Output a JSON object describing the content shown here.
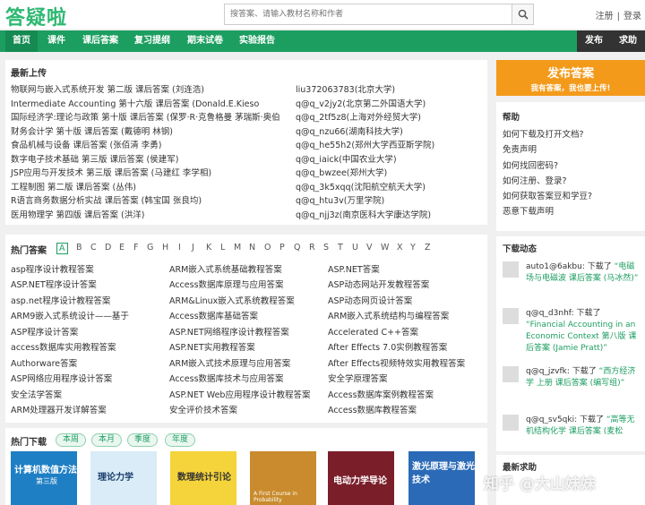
{
  "logo": "答疑啦",
  "search": {
    "placeholder": "搜答案、请输入教材名称和作者"
  },
  "auth": {
    "register": "注册",
    "separator": "|",
    "login": "登录"
  },
  "nav": {
    "items": [
      "首页",
      "课件",
      "课后答案",
      "复习提纲",
      "期末试卷",
      "实验报告"
    ],
    "right": [
      "发布",
      "求助"
    ]
  },
  "latest": {
    "title": "最新上传",
    "rows": [
      {
        "book": "物联网与嵌入式系统开发 第二版 课后答案 (刘连浩)",
        "user": "liu372063783(北京大学)"
      },
      {
        "book": "Intermediate Accounting 第十六版 课后答案 (Donald.E.Kieso",
        "user": "q@q_v2jy2(北京第二外国语大学)"
      },
      {
        "book": "国际经济学:理论与政策 第十版 课后答案 (保罗·R·克鲁格曼 茅瑞斯·奥伯",
        "user": "q@q_2tf5z8(上海对外经贸大学)"
      },
      {
        "book": "财务会计学 第十版 课后答案 (戴德明 林钢)",
        "user": "q@q_nzu66(湖南科技大学)"
      },
      {
        "book": "食品机械与设备 课后答案 (张佰清 李勇)",
        "user": "q@q_he55h2(郑州大学西亚斯学院)"
      },
      {
        "book": "数字电子技术基础 第三版 课后答案 (侯建军)",
        "user": "q@q_iaick(中国农业大学)"
      },
      {
        "book": "JSP应用与开发技术 第三版 课后答案 (马建红 李学相)",
        "user": "q@q_bwzee(郑州大学)"
      },
      {
        "book": "工程制图 第二版 课后答案 (丛伟)",
        "user": "q@q_3k5xqq(沈阳航空航天大学)"
      },
      {
        "book": "R语言商务数据分析实战 课后答案 (韩宝国 张良均)",
        "user": "q@q_htu3v(万里学院)"
      },
      {
        "book": "医用物理学 第四版 课后答案 (洪洋)",
        "user": "q@q_njj3z(南京医科大学康达学院)"
      }
    ]
  },
  "hot": {
    "title": "热门答案",
    "letters": [
      "A",
      "B",
      "C",
      "D",
      "E",
      "F",
      "G",
      "H",
      "I",
      "J",
      "K",
      "L",
      "M",
      "N",
      "O",
      "P",
      "Q",
      "R",
      "S",
      "T",
      "U",
      "V",
      "W",
      "X",
      "Y",
      "Z"
    ],
    "col1": [
      "asp程序设计教程答案",
      "ASP.NET程序设计答案",
      "asp.net程序设计教程答案",
      "ARM9嵌入式系统设计——基于",
      "ASP程序设计答案",
      "access数据库实用教程答案",
      "Authorware答案",
      "ASP网络应用程序设计答案",
      "安全法学答案",
      "ARM处理器开发详解答案"
    ],
    "col2": [
      "ARM嵌入式系统基础教程答案",
      "Access数据库原理与应用答案",
      "ARM&Linux嵌入式系统教程答案",
      "Access数据库基础答案",
      "ASP.NET网络程序设计教程答案",
      "ASP.NET实用教程答案",
      "ARM嵌入式技术原理与应用答案",
      "Access数据库技术与应用答案",
      "ASP.NET Web应用程序设计教程答案",
      "安全评价技术答案"
    ],
    "col3": [
      "ASP.NET答案",
      "ASP动态网站开发教程答案",
      "ASP动态网页设计答案",
      "ARM嵌入式系统结构与编程答案",
      "Accelerated C++答案",
      "After Effects 7.0实例教程答案",
      "After Effects视频特效实用教程答案",
      "安全学原理答案",
      "Access数据库案例教程答案",
      "Access数据库教程答案"
    ]
  },
  "downloads": {
    "title": "热门下载",
    "tabs": [
      "本周",
      "本月",
      "季度",
      "年度"
    ],
    "books": [
      {
        "title": "计算机数值方法",
        "sub": "第三版"
      },
      {
        "title": "理论力学",
        "sub": ""
      },
      {
        "title": "数理统计引论",
        "sub": ""
      },
      {
        "title": "",
        "sub": "A First Course in Probability"
      },
      {
        "title": "电动力学导论",
        "sub": ""
      },
      {
        "title": "激光原理与激光技术",
        "sub": ""
      }
    ]
  },
  "publish": {
    "title": "发布答案",
    "subtitle": "我有答案，我也要上传!"
  },
  "help": {
    "title": "帮助",
    "items": [
      "如何下载及打开文档?",
      "免责声明",
      "如何找回密码?",
      "如何注册、登录?",
      "如何获取答案豆和学豆?",
      "恶意下载声明"
    ]
  },
  "activity": {
    "title": "下载动态",
    "items": [
      {
        "user": "auto1@6akbu:",
        "action": "下载了",
        "book": "“电磁场与电磁波 课后答案 (马冰然)”"
      },
      {
        "user": "q@q_d3nhf:",
        "action": "下载了",
        "book": "“Financial Accounting in an Economic Context 第八版 课后答案 (Jamie Pratt)”"
      },
      {
        "user": "q@q_jzvfk:",
        "action": "下载了",
        "book": "“西方经济学 上册 课后答案 (编写组)”"
      },
      {
        "user": "q@q_sv5qki:",
        "action": "下载了",
        "book": "“高等无机结构化学 课后答案 (麦松"
      }
    ]
  },
  "requests": {
    "title": "最新求助"
  },
  "watermark": "知乎 @大山妹妹",
  "colors": {
    "brand": "#1d9e61",
    "accent": "#f39a1b"
  }
}
